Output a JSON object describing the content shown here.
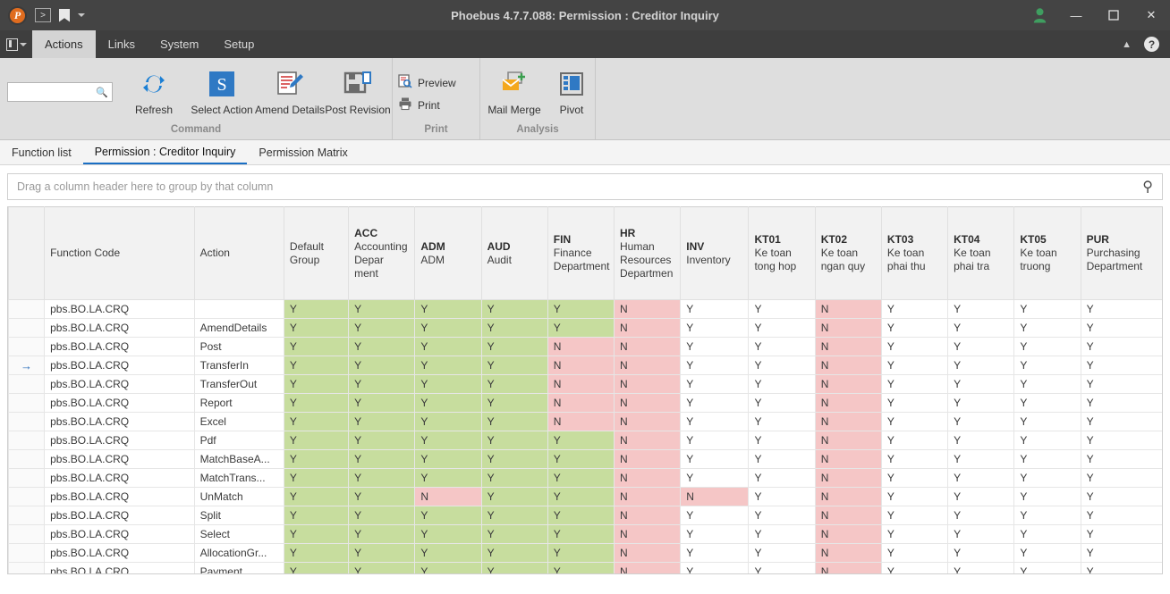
{
  "window": {
    "title": "Phoebus 4.7.7.088: Permission : Creditor Inquiry",
    "logo_letter": "P",
    "quick_access": {
      "run_label": ">",
      "bookmark_icon": "bookmark-icon",
      "dropdown_icon": "chevron-down-icon"
    },
    "controls": {
      "user_icon": "user-icon",
      "minimize": "—",
      "maximize": "☐",
      "close": "✕"
    }
  },
  "menubar": {
    "system_icon": "system-menu-icon",
    "items": [
      {
        "label": "Actions",
        "active": true
      },
      {
        "label": "Links",
        "active": false
      },
      {
        "label": "System",
        "active": false
      },
      {
        "label": "Setup",
        "active": false
      }
    ],
    "collapse_icon": "chevron-up-icon",
    "help_label": "?"
  },
  "ribbon": {
    "search": {
      "value": "",
      "placeholder": "",
      "icon": "search-icon"
    },
    "groups": [
      {
        "name": "Command",
        "label": "Command",
        "items": [
          {
            "label": "Refresh",
            "icon": "refresh-icon"
          },
          {
            "label": "Select Action",
            "icon": "select-action-icon"
          },
          {
            "label": "Amend Details",
            "icon": "amend-details-icon"
          },
          {
            "label": "Post Revision",
            "icon": "post-revision-icon"
          }
        ]
      },
      {
        "name": "Print",
        "label": "Print",
        "items": [
          {
            "label": "Preview",
            "icon": "preview-icon"
          },
          {
            "label": "Print",
            "icon": "printer-icon"
          }
        ]
      },
      {
        "name": "Analysis",
        "label": "Analysis",
        "items": [
          {
            "label": "Mail Merge",
            "icon": "mail-merge-icon"
          },
          {
            "label": "Pivot",
            "icon": "pivot-icon"
          }
        ]
      }
    ]
  },
  "doctabs": [
    {
      "label": "Function list",
      "selected": false
    },
    {
      "label": "Permission : Creditor Inquiry",
      "selected": true
    },
    {
      "label": "Permission Matrix",
      "selected": false
    }
  ],
  "grouppanel": {
    "hint": "Drag a column header here to group by that column",
    "search_icon": "search-icon"
  },
  "grid": {
    "columns": [
      {
        "key": "gutter",
        "code": "",
        "desc": "",
        "cls": "gutter"
      },
      {
        "key": "function_code",
        "code": "",
        "desc": "Function Code",
        "cls": "col-fn"
      },
      {
        "key": "action",
        "code": "",
        "desc": "Action",
        "cls": "col-ac"
      },
      {
        "key": "default_group",
        "code": "",
        "desc": "Default Group",
        "cls": "col-dg"
      },
      {
        "key": "ACC",
        "code": "ACC",
        "desc": "Accounting Depar ment",
        "cls": "col-dep"
      },
      {
        "key": "ADM",
        "code": "ADM",
        "desc": "ADM",
        "cls": "col-dep"
      },
      {
        "key": "AUD",
        "code": "AUD",
        "desc": "Audit",
        "cls": "col-dep"
      },
      {
        "key": "FIN",
        "code": "FIN",
        "desc": "Finance Department",
        "cls": "col-dep"
      },
      {
        "key": "HR",
        "code": "HR",
        "desc": "Human Resources Departmen",
        "cls": "col-dep"
      },
      {
        "key": "INV",
        "code": "INV",
        "desc": "Inventory",
        "cls": "col-inv"
      },
      {
        "key": "KT01",
        "code": "KT01",
        "desc": "Ke toan tong hop",
        "cls": "col-kt"
      },
      {
        "key": "KT02",
        "code": "KT02",
        "desc": "Ke toan ngan quy",
        "cls": "col-kt"
      },
      {
        "key": "KT03",
        "code": "KT03",
        "desc": "Ke toan phai thu",
        "cls": "col-kt"
      },
      {
        "key": "KT04",
        "code": "KT04",
        "desc": "Ke toan phai tra",
        "cls": "col-kt"
      },
      {
        "key": "KT05",
        "code": "KT05",
        "desc": "Ke toan truong",
        "cls": "col-kt5"
      },
      {
        "key": "PUR",
        "code": "PUR",
        "desc": "Purchasing Department",
        "cls": "col-pur"
      }
    ],
    "current_row_index": 3,
    "current_row_marker": "→",
    "rows": [
      {
        "function_code": "pbs.BO.LA.CRQ",
        "action": "",
        "cells": [
          "Y",
          "Y",
          "Y",
          "Y",
          "Y",
          "N",
          "Y",
          "Y",
          "N",
          "Y",
          "Y",
          "Y",
          "Y"
        ]
      },
      {
        "function_code": "pbs.BO.LA.CRQ",
        "action": "AmendDetails",
        "cells": [
          "Y",
          "Y",
          "Y",
          "Y",
          "Y",
          "N",
          "Y",
          "Y",
          "N",
          "Y",
          "Y",
          "Y",
          "Y"
        ]
      },
      {
        "function_code": "pbs.BO.LA.CRQ",
        "action": "Post",
        "cells": [
          "Y",
          "Y",
          "Y",
          "Y",
          "N",
          "N",
          "Y",
          "Y",
          "N",
          "Y",
          "Y",
          "Y",
          "Y"
        ]
      },
      {
        "function_code": "pbs.BO.LA.CRQ",
        "action": "TransferIn",
        "cells": [
          "Y",
          "Y",
          "Y",
          "Y",
          "N",
          "N",
          "Y",
          "Y",
          "N",
          "Y",
          "Y",
          "Y",
          "Y"
        ]
      },
      {
        "function_code": "pbs.BO.LA.CRQ",
        "action": "TransferOut",
        "cells": [
          "Y",
          "Y",
          "Y",
          "Y",
          "N",
          "N",
          "Y",
          "Y",
          "N",
          "Y",
          "Y",
          "Y",
          "Y"
        ]
      },
      {
        "function_code": "pbs.BO.LA.CRQ",
        "action": "Report",
        "cells": [
          "Y",
          "Y",
          "Y",
          "Y",
          "N",
          "N",
          "Y",
          "Y",
          "N",
          "Y",
          "Y",
          "Y",
          "Y"
        ]
      },
      {
        "function_code": "pbs.BO.LA.CRQ",
        "action": "Excel",
        "cells": [
          "Y",
          "Y",
          "Y",
          "Y",
          "N",
          "N",
          "Y",
          "Y",
          "N",
          "Y",
          "Y",
          "Y",
          "Y"
        ]
      },
      {
        "function_code": "pbs.BO.LA.CRQ",
        "action": "Pdf",
        "cells": [
          "Y",
          "Y",
          "Y",
          "Y",
          "Y",
          "N",
          "Y",
          "Y",
          "N",
          "Y",
          "Y",
          "Y",
          "Y"
        ]
      },
      {
        "function_code": "pbs.BO.LA.CRQ",
        "action": "MatchBaseA...",
        "cells": [
          "Y",
          "Y",
          "Y",
          "Y",
          "Y",
          "N",
          "Y",
          "Y",
          "N",
          "Y",
          "Y",
          "Y",
          "Y"
        ]
      },
      {
        "function_code": "pbs.BO.LA.CRQ",
        "action": "MatchTrans...",
        "cells": [
          "Y",
          "Y",
          "Y",
          "Y",
          "Y",
          "N",
          "Y",
          "Y",
          "N",
          "Y",
          "Y",
          "Y",
          "Y"
        ]
      },
      {
        "function_code": "pbs.BO.LA.CRQ",
        "action": "UnMatch",
        "cells": [
          "Y",
          "Y",
          "N",
          "Y",
          "Y",
          "N",
          "N",
          "Y",
          "N",
          "Y",
          "Y",
          "Y",
          "Y"
        ]
      },
      {
        "function_code": "pbs.BO.LA.CRQ",
        "action": "Split",
        "cells": [
          "Y",
          "Y",
          "Y",
          "Y",
          "Y",
          "N",
          "Y",
          "Y",
          "N",
          "Y",
          "Y",
          "Y",
          "Y"
        ]
      },
      {
        "function_code": "pbs.BO.LA.CRQ",
        "action": "Select",
        "cells": [
          "Y",
          "Y",
          "Y",
          "Y",
          "Y",
          "N",
          "Y",
          "Y",
          "N",
          "Y",
          "Y",
          "Y",
          "Y"
        ]
      },
      {
        "function_code": "pbs.BO.LA.CRQ",
        "action": "AllocationGr...",
        "cells": [
          "Y",
          "Y",
          "Y",
          "Y",
          "Y",
          "N",
          "Y",
          "Y",
          "N",
          "Y",
          "Y",
          "Y",
          "Y"
        ]
      },
      {
        "function_code": "pbs.BO.LA.CRQ",
        "action": "Payment",
        "cells": [
          "Y",
          "Y",
          "Y",
          "Y",
          "Y",
          "N",
          "Y",
          "Y",
          "N",
          "Y",
          "Y",
          "Y",
          "Y"
        ]
      }
    ],
    "colored_columns": [
      "default_group",
      "ACC",
      "ADM",
      "AUD",
      "FIN",
      "HR"
    ],
    "colors": {
      "yes": "#c7dd9e",
      "no": "#f5c6c6",
      "plain": "#ffffff"
    }
  }
}
